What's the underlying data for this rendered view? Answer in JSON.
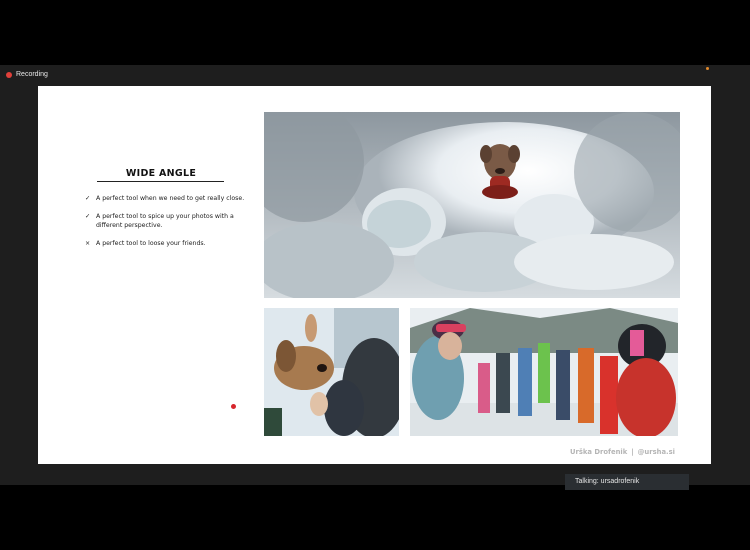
{
  "recording": {
    "label": "Recording"
  },
  "slide": {
    "title": "WIDE ANGLE",
    "bullets": [
      {
        "mark": "✓",
        "text": "A perfect tool when we need to get really close."
      },
      {
        "mark": "✓",
        "text": "A perfect tool to spice up your photos with a different perspective."
      },
      {
        "mark": "×",
        "text": "A perfect tool to loose your friends."
      }
    ],
    "credit": {
      "name": "Urška Drofenik",
      "separator": "|",
      "handle": "@ursha.si"
    }
  },
  "speaker": {
    "label": "Talking: ursadrofenik"
  },
  "colors": {
    "recording_dot": "#e0403a",
    "pointer": "#d7262c",
    "status_dot": "#e28a2b"
  }
}
